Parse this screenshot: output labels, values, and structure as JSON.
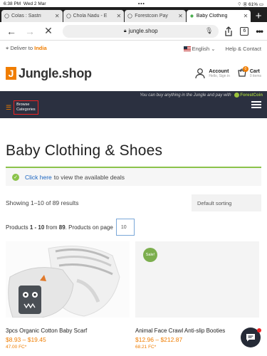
{
  "statusbar": {
    "time": "6:38 PM",
    "date": "Wed 2 Mar",
    "dots": "•••",
    "battery": "61%"
  },
  "browser": {
    "tabs": [
      {
        "label": "Colas : Sastri",
        "active": false
      },
      {
        "label": "Chola Nadu - E",
        "active": false
      },
      {
        "label": "Forestcoin Pay",
        "active": false
      },
      {
        "label": "Baby Clothing",
        "active": true
      }
    ],
    "url": "jungle.shop",
    "tab_count": "6"
  },
  "topbar": {
    "deliver_prefix": "Deliver to",
    "deliver_country": "India",
    "language": "English",
    "help": "Help & Contact"
  },
  "header": {
    "logo_letter": "J",
    "logo_text": "Jungle.shop",
    "account_title": "Account",
    "account_sub": "Hello, Sign in",
    "cart_title": "Cart",
    "cart_sub": "0 items",
    "cart_badge": "0"
  },
  "navbar": {
    "promo_text": "You can buy anything in the Jungle and pay with",
    "promo_coin": "ForestCoin",
    "browse_line1": "Browse",
    "browse_line2": "Categories"
  },
  "page": {
    "title": "Baby Clothing & Shoes",
    "notice_link": "Click here",
    "notice_text": "to view the available deals",
    "results": "Showing 1–10 of 89 results",
    "sort": "Default sorting",
    "perpage_a": "Products",
    "perpage_range": "1 - 10",
    "perpage_b": "from",
    "perpage_total": "89",
    "perpage_c": ". Products on page",
    "perpage_value": "10"
  },
  "products": [
    {
      "name": "3pcs Organic Cotton Baby Scarf",
      "price": "$8.93 – $19.45",
      "fc": "47.00 FC*",
      "sale": ""
    },
    {
      "name": "Animal Face Crawl Anti-slip Booties",
      "price": "$12.96 – $212.87",
      "fc": "68.21 FC*",
      "sale": "Sale!"
    }
  ],
  "colors": {
    "accent": "#f07d00",
    "nav": "#2b3040",
    "green": "#8bc34a",
    "link": "#1a64c0"
  }
}
